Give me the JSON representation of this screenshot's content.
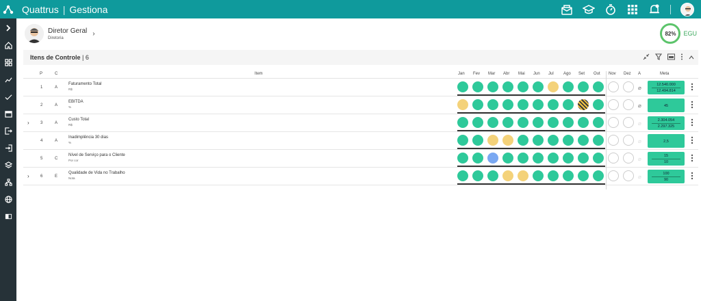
{
  "app": {
    "brand": "Quattrus",
    "module": "Gestiona"
  },
  "profile": {
    "name": "Diretor Geral",
    "role": "Diretoria"
  },
  "score": {
    "value": "82%",
    "label": "EGU",
    "color": "#5cc46b"
  },
  "panel": {
    "title": "Itens de Controle",
    "count": "6"
  },
  "columns": {
    "p": "P",
    "c": "C",
    "item": "Item",
    "months": [
      "Jan",
      "Fev",
      "Mar",
      "Abr",
      "Mai",
      "Jun",
      "Jul",
      "Ago",
      "Set",
      "Out",
      "Nov",
      "Dez"
    ],
    "a": "A",
    "meta": "Meta"
  },
  "rows": [
    {
      "p": "1",
      "c": "A",
      "name": "Faturamento Total",
      "unit": "R$",
      "expand": "",
      "dots": [
        "g",
        "g",
        "g",
        "g",
        "g",
        "g",
        "y",
        "g",
        "g",
        "g",
        "e",
        "e"
      ],
      "meta1": "12.540.000",
      "meta2": "12.494.814",
      "attach": true
    },
    {
      "p": "2",
      "c": "A",
      "name": "EBITDA",
      "unit": "%",
      "expand": "",
      "dots": [
        "y",
        "g",
        "g",
        "g",
        "g",
        "g",
        "g",
        "g",
        "h",
        "g",
        "e",
        "e"
      ],
      "meta1": "",
      "meta2": "45",
      "attach": true
    },
    {
      "p": "3",
      "c": "A",
      "name": "Custo Total",
      "unit": "R$",
      "expand": "›",
      "dots": [
        "g",
        "g",
        "g",
        "g",
        "g",
        "g",
        "g",
        "g",
        "g",
        "g",
        "e",
        "e"
      ],
      "meta1": "2.304.054",
      "meta2": "2.297.325",
      "attach": false
    },
    {
      "p": "4",
      "c": "A",
      "name": "Inadimplência 30 dias",
      "unit": "%",
      "expand": "",
      "dots": [
        "g",
        "g",
        "y",
        "y",
        "g",
        "g",
        "g",
        "g",
        "g",
        "g",
        "e",
        "e"
      ],
      "meta1": "",
      "meta2": "2,5",
      "attach": false
    },
    {
      "p": "5",
      "c": "C",
      "name": "Nível de Serviço para o Cliente",
      "unit": "Por cor",
      "expand": "",
      "dots": [
        "g",
        "g",
        "b",
        "g",
        "g",
        "g",
        "g",
        "g",
        "g",
        "g",
        "e",
        "e"
      ],
      "meta1": "15",
      "meta2": "10",
      "attach": false
    },
    {
      "p": "6",
      "c": "E",
      "name": "Qualidade de Vida no Trabalho",
      "unit": "Nota",
      "expand": "›",
      "dots": [
        "g",
        "g",
        "g",
        "y",
        "y",
        "g",
        "g",
        "g",
        "g",
        "g",
        "e",
        "e"
      ],
      "meta1": "100",
      "meta2": "90",
      "attach": false
    }
  ],
  "colors": {
    "topbar": "#0f9a9c",
    "sidebar": "#263238",
    "green": "#2ec99a",
    "yellow": "#f4d27a",
    "blue": "#7aa8f2"
  },
  "icons": {
    "top": [
      "mail-icon",
      "graduation-cap-icon",
      "stopwatch-icon",
      "apps-grid-icon",
      "bell-icon",
      "user-avatar"
    ],
    "sidebar": [
      "chevron-right-icon",
      "home-icon",
      "dashboard-icon",
      "trend-icon",
      "check-trend-icon",
      "calendar-icon",
      "export-icon",
      "logout-icon",
      "layers-icon",
      "hierarchy-icon",
      "globe-icon",
      "book-icon"
    ],
    "panel": [
      "collapse-icon",
      "filter-icon",
      "table-view-icon",
      "more-icon",
      "chevron-up-icon"
    ]
  }
}
